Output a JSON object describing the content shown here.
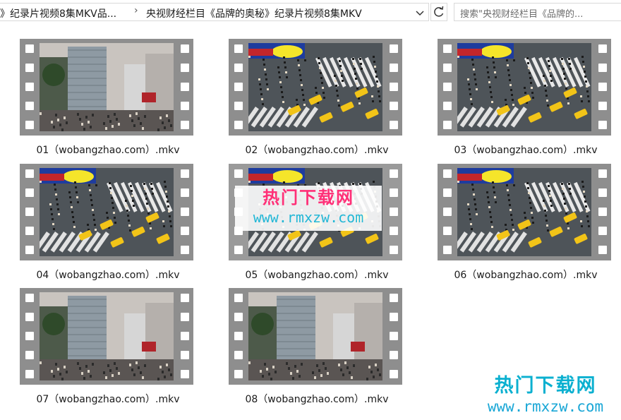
{
  "address_bar": {
    "crumb_parent": "》纪录片视频8集MKV品...",
    "separator": "›",
    "crumb_current": "央视财经栏目《品牌的奥秘》纪录片视频8集MKV"
  },
  "search": {
    "placeholder": "搜索\"央视财经栏目《品牌的..."
  },
  "files": [
    {
      "name": "01（wobangzhao.com）.mkv",
      "scene": "street",
      "selected": false
    },
    {
      "name": "02（wobangzhao.com）.mkv",
      "scene": "crossing",
      "selected": false
    },
    {
      "name": "03（wobangzhao.com）.mkv",
      "scene": "crossing",
      "selected": false
    },
    {
      "name": "04（wobangzhao.com）.mkv",
      "scene": "crossing",
      "selected": false
    },
    {
      "name": "05（wobangzhao.com）.mkv",
      "scene": "crossing",
      "selected": true
    },
    {
      "name": "06（wobangzhao.com）.mkv",
      "scene": "crossing",
      "selected": false
    },
    {
      "name": "07（wobangzhao.com）.mkv",
      "scene": "street",
      "selected": false
    },
    {
      "name": "08（wobangzhao.com）.mkv",
      "scene": "street",
      "selected": false
    }
  ],
  "watermarks": [
    {
      "title": "热门下载网",
      "url": "www.rmxzw.com"
    },
    {
      "title": "热门下载网",
      "url": "www.rmxzw.com"
    }
  ]
}
